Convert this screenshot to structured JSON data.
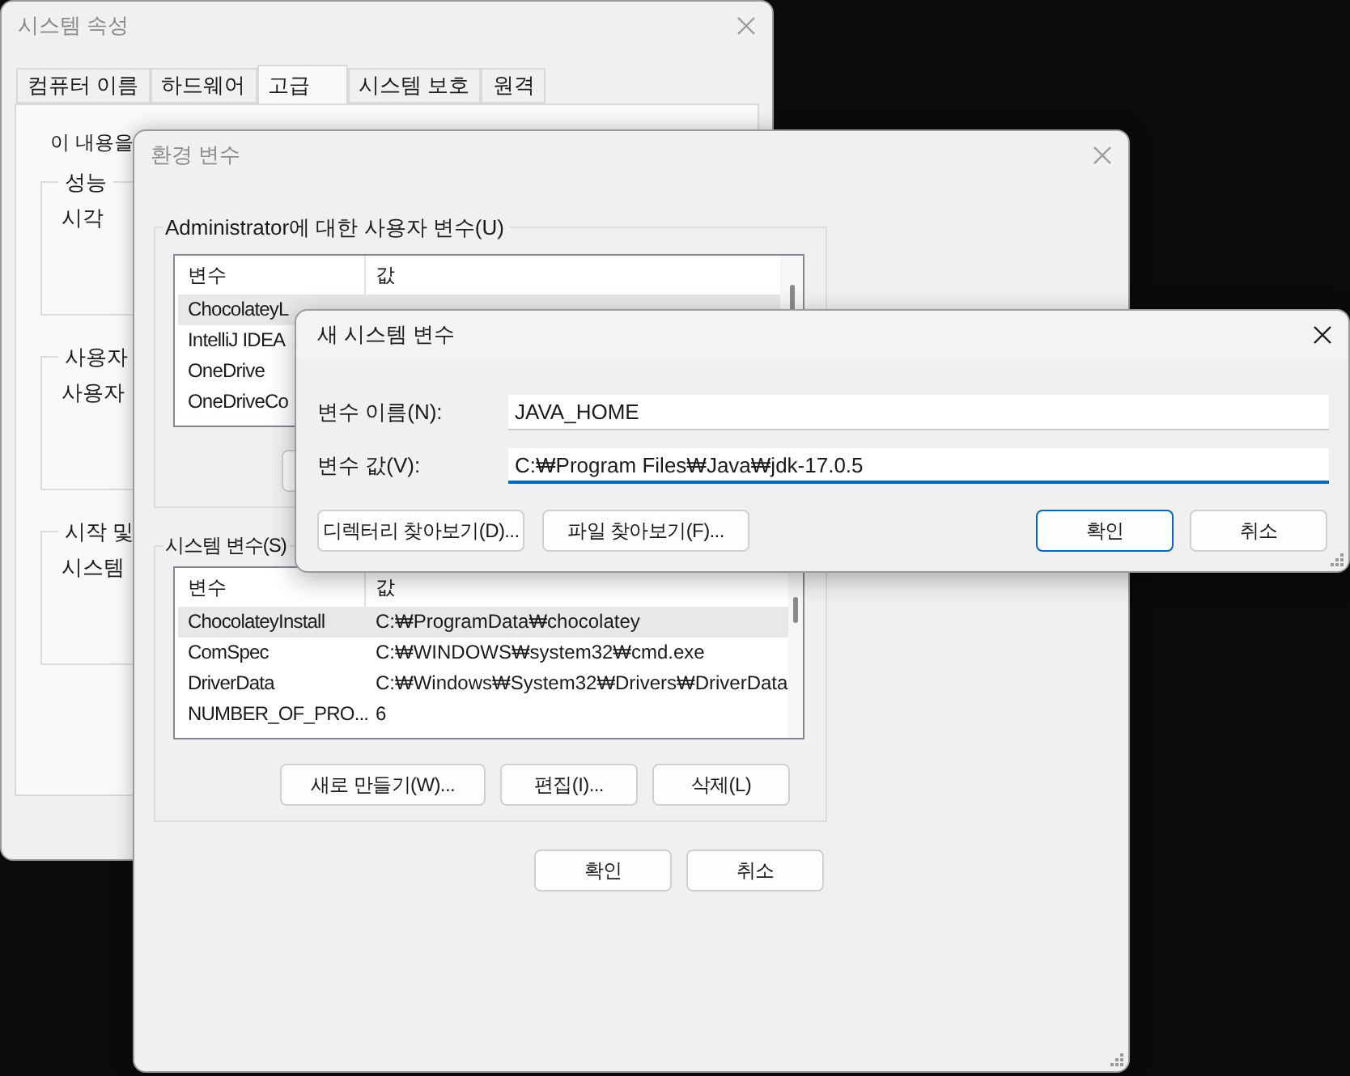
{
  "system_properties": {
    "title": "시스템 속성",
    "active": false,
    "tabs": [
      {
        "label": "컴퓨터 이름",
        "selected": false
      },
      {
        "label": "하드웨어",
        "selected": false
      },
      {
        "label": "고급",
        "selected": true
      },
      {
        "label": "시스템 보호",
        "selected": false
      },
      {
        "label": "원격",
        "selected": false
      }
    ],
    "intro": "이 내용을",
    "groups": [
      {
        "title": "성능",
        "text": "시각"
      },
      {
        "title": "사용자",
        "text": "사용자"
      },
      {
        "title": "시작 및",
        "text": "시스템"
      }
    ]
  },
  "environment_variables": {
    "title": "환경 변수",
    "active": false,
    "user_variables": {
      "title": "Administrator에 대한 사용자 변수(U)",
      "columns": [
        "변수",
        "값"
      ],
      "rows": [
        {
          "name": "ChocolateyL",
          "selected": true
        },
        {
          "name": "IntelliJ IDEA",
          "selected": false
        },
        {
          "name": "OneDrive",
          "selected": false
        },
        {
          "name": "OneDriveCo",
          "selected": false
        }
      ]
    },
    "system_variables": {
      "title": "시스템 변수(S)",
      "columns": [
        "변수",
        "값"
      ],
      "rows": [
        {
          "name": "ChocolateyInstall",
          "value": "C:₩ProgramData₩chocolatey",
          "selected": true
        },
        {
          "name": "ComSpec",
          "value": "C:₩WINDOWS₩system32₩cmd.exe",
          "selected": false
        },
        {
          "name": "DriverData",
          "value": "C:₩Windows₩System32₩Drivers₩DriverData",
          "selected": false
        },
        {
          "name": "NUMBER_OF_PRO...",
          "value": "6",
          "selected": false
        }
      ],
      "buttons": [
        "새로 만들기(W)...",
        "편집(I)...",
        "삭제(L)"
      ]
    },
    "buttons": [
      {
        "label": "확인",
        "default": false
      },
      {
        "label": "취소",
        "default": false
      }
    ]
  },
  "new_system_variable": {
    "title": "새 시스템 변수",
    "active": true,
    "fields": [
      {
        "label": "변수 이름(N):",
        "value": "JAVA_HOME",
        "focused": false
      },
      {
        "label": "변수 값(V):",
        "value": "C:₩Program Files₩Java₩jdk-17.0.5",
        "focused": true
      }
    ],
    "browse_buttons": [
      "디렉터리 찾아보기(D)...",
      "파일 찾아보기(F)..."
    ],
    "buttons": [
      {
        "label": "확인",
        "default": true
      },
      {
        "label": "취소",
        "default": false
      }
    ]
  }
}
